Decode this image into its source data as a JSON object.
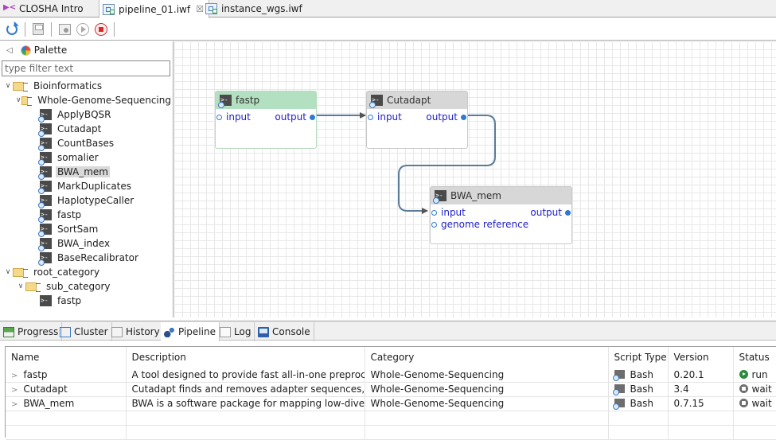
{
  "editor_tabs": [
    {
      "label": "CLOSHA Intro",
      "icon": "closha-logo-icon",
      "active": false
    },
    {
      "label": "pipeline_01.iwf",
      "icon": "pipeline-file-icon",
      "active": true,
      "close": "☒"
    },
    {
      "label": "instance_wgs.iwf",
      "icon": "pipeline-file-icon",
      "active": false
    }
  ],
  "toolbar": {
    "buttons": [
      "refresh-icon",
      "save-icon",
      "run-config-icon",
      "run-icon",
      "stop-icon"
    ]
  },
  "palette": {
    "title": "Palette",
    "filter_placeholder": "type filter text",
    "filter_value": "",
    "tree": [
      {
        "label": "Bioinformatics",
        "level": 0,
        "type": "category"
      },
      {
        "label": "Whole-Genome-Sequencing",
        "level": 1,
        "type": "subcategory"
      },
      {
        "label": "ApplyBQSR",
        "level": 2,
        "type": "tool"
      },
      {
        "label": "Cutadapt",
        "level": 2,
        "type": "tool"
      },
      {
        "label": "CountBases",
        "level": 2,
        "type": "tool"
      },
      {
        "label": "somalier",
        "level": 2,
        "type": "tool"
      },
      {
        "label": "BWA_mem",
        "level": 2,
        "type": "tool",
        "selected": true
      },
      {
        "label": "MarkDuplicates",
        "level": 2,
        "type": "tool"
      },
      {
        "label": "HaplotypeCaller",
        "level": 2,
        "type": "tool"
      },
      {
        "label": "fastp",
        "level": 2,
        "type": "tool"
      },
      {
        "label": "SortSam",
        "level": 2,
        "type": "tool"
      },
      {
        "label": "BWA_index",
        "level": 2,
        "type": "tool"
      },
      {
        "label": "BaseRecalibrator",
        "level": 2,
        "type": "tool"
      },
      {
        "label": "root_category",
        "level": 0,
        "type": "category"
      },
      {
        "label": "sub_category",
        "level": 1,
        "type": "subcategory"
      },
      {
        "label": "fastp",
        "level": 2,
        "type": "tool-plain"
      }
    ]
  },
  "canvas": {
    "nodes": [
      {
        "name": "fastp",
        "state": "running",
        "inputs": [
          "input"
        ],
        "outputs": [
          "output"
        ]
      },
      {
        "name": "Cutadapt",
        "state": "waiting",
        "inputs": [
          "input"
        ],
        "outputs": [
          "output"
        ]
      },
      {
        "name": "BWA_mem",
        "state": "waiting",
        "inputs": [
          "input",
          "genome reference"
        ],
        "outputs": [
          "output"
        ]
      }
    ],
    "connections": [
      {
        "from": "fastp.output",
        "to": "Cutadapt.input"
      },
      {
        "from": "Cutadapt.output",
        "to": "BWA_mem.input"
      }
    ],
    "colors": {
      "running_header": "#b2e0c1",
      "waiting_header": "#d7d7d7",
      "port_text": "#2020c8",
      "wire": "#5a7a9a"
    }
  },
  "views": {
    "tabs": [
      {
        "label": "Progress",
        "icon": "progress-icon"
      },
      {
        "label": "Cluster",
        "icon": "cluster-icon"
      },
      {
        "label": "History",
        "icon": "history-icon"
      },
      {
        "label": "Pipeline",
        "icon": "pipeline-icon",
        "active": true
      },
      {
        "label": "Log",
        "icon": "log-icon"
      },
      {
        "label": "Console",
        "icon": "console-icon"
      }
    ]
  },
  "pipeline_table": {
    "columns": [
      "Name",
      "Description",
      "Category",
      "Script Type",
      "Version",
      "Status"
    ],
    "rows": [
      {
        "name": "fastp",
        "description": "A tool designed to provide fast all-in-one preproces...",
        "category": "Whole-Genome-Sequencing",
        "script_type": "Bash",
        "version": "0.20.1",
        "status": "run"
      },
      {
        "name": "Cutadapt",
        "description": "Cutadapt finds and removes adapter sequences, pri...",
        "category": "Whole-Genome-Sequencing",
        "script_type": "Bash",
        "version": "3.4",
        "status": "wait"
      },
      {
        "name": "BWA_mem",
        "description": "BWA is a software package for mapping low-diverge...",
        "category": "Whole-Genome-Sequencing",
        "script_type": "Bash",
        "version": "0.7.15",
        "status": "wait"
      }
    ]
  }
}
